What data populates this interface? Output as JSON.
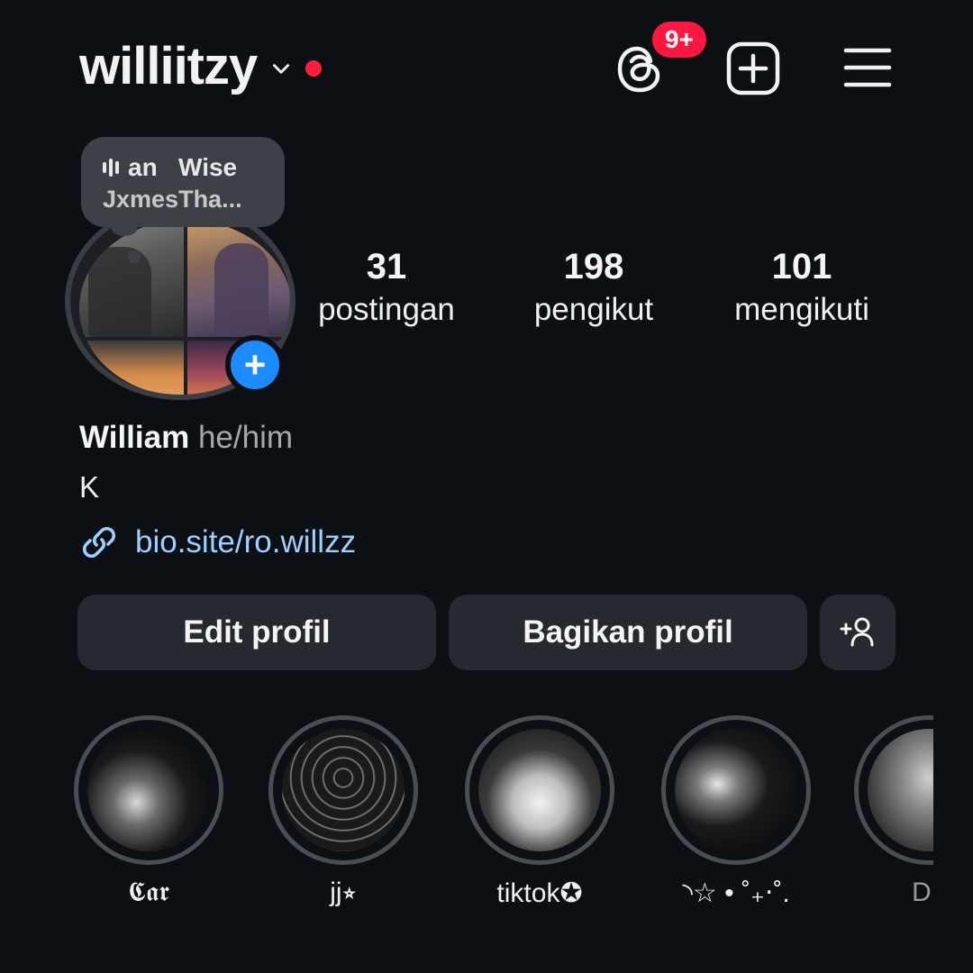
{
  "header": {
    "username": "williitzy",
    "notification_badge": "9+",
    "colors": {
      "badge": "#ff1744",
      "online_dot": "#ff1f3d"
    }
  },
  "note": {
    "track_title": "an   Wise",
    "artist": "JxmesTha..."
  },
  "stats": [
    {
      "value": "31",
      "label": "postingan"
    },
    {
      "value": "198",
      "label": "pengikut"
    },
    {
      "value": "101",
      "label": "mengikuti"
    }
  ],
  "profile": {
    "name": "William",
    "pronouns": "he/him",
    "bio": "K",
    "link": "bio.site/ro.willzz",
    "link_color": "#9fcfff"
  },
  "actions": {
    "edit_label": "Edit profil",
    "share_label": "Bagikan profil",
    "add_friend_icon": "person-add-icon"
  },
  "highlights": [
    {
      "label": "𝕮𝖆𝖗"
    },
    {
      "label": "jj⭒"
    },
    {
      "label": "tiktok✪"
    },
    {
      "label": "◝☆ • ˚₊‧˚."
    },
    {
      "label": "D"
    }
  ],
  "icons": {
    "threads": "threads-icon",
    "new_post": "plus-square-icon",
    "menu": "hamburger-menu-icon",
    "link": "link-icon",
    "avatar_add": "plus-icon"
  }
}
